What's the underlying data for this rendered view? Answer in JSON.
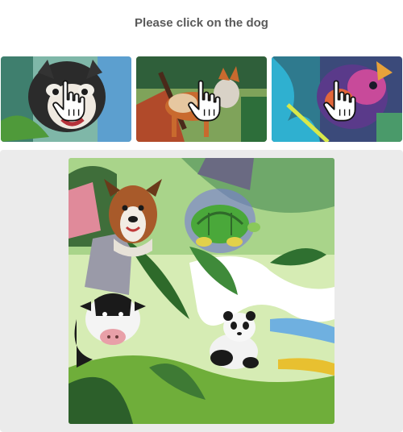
{
  "captcha": {
    "instruction": "Please click on the dog",
    "examples": [
      {
        "name": "dog",
        "icon": "hand-pointer-icon"
      },
      {
        "name": "dog",
        "icon": "hand-pointer-icon"
      },
      {
        "name": "dog",
        "icon": "hand-pointer-icon"
      }
    ],
    "scene": {
      "animals": [
        "dog",
        "turtle",
        "cow",
        "panda"
      ]
    },
    "colors": {
      "panel_bg": "#ebebeb",
      "instruction_text": "#5a5a5a"
    }
  }
}
